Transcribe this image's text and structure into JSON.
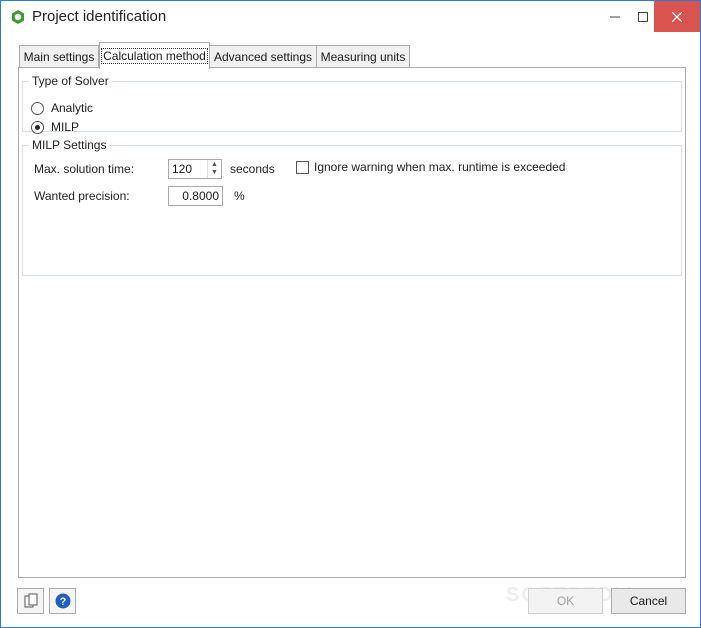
{
  "window": {
    "title": "Project identification"
  },
  "tabs": [
    {
      "label": "Main settings"
    },
    {
      "label": "Calculation method"
    },
    {
      "label": "Advanced settings"
    },
    {
      "label": "Measuring units"
    }
  ],
  "solver": {
    "legend": "Type of Solver",
    "options": [
      {
        "label": "Analytic",
        "selected": false
      },
      {
        "label": "MILP",
        "selected": true
      }
    ]
  },
  "milp": {
    "legend": "MILP Settings",
    "max_time_label": "Max. solution time:",
    "max_time_value": "120",
    "max_time_unit": "seconds",
    "ignore_warning_label": "Ignore warning when max. runtime is exceeded",
    "ignore_warning_checked": false,
    "precision_label": "Wanted precision:",
    "precision_value": "0.8000",
    "precision_unit": "%"
  },
  "footer": {
    "ok_label": "OK",
    "cancel_label": "Cancel"
  },
  "watermark": "SOFTPEDIA",
  "colors": {
    "border_accent": "#2b79d8",
    "close_hover": "#d9534f",
    "help_blue": "#1f5fbf"
  }
}
